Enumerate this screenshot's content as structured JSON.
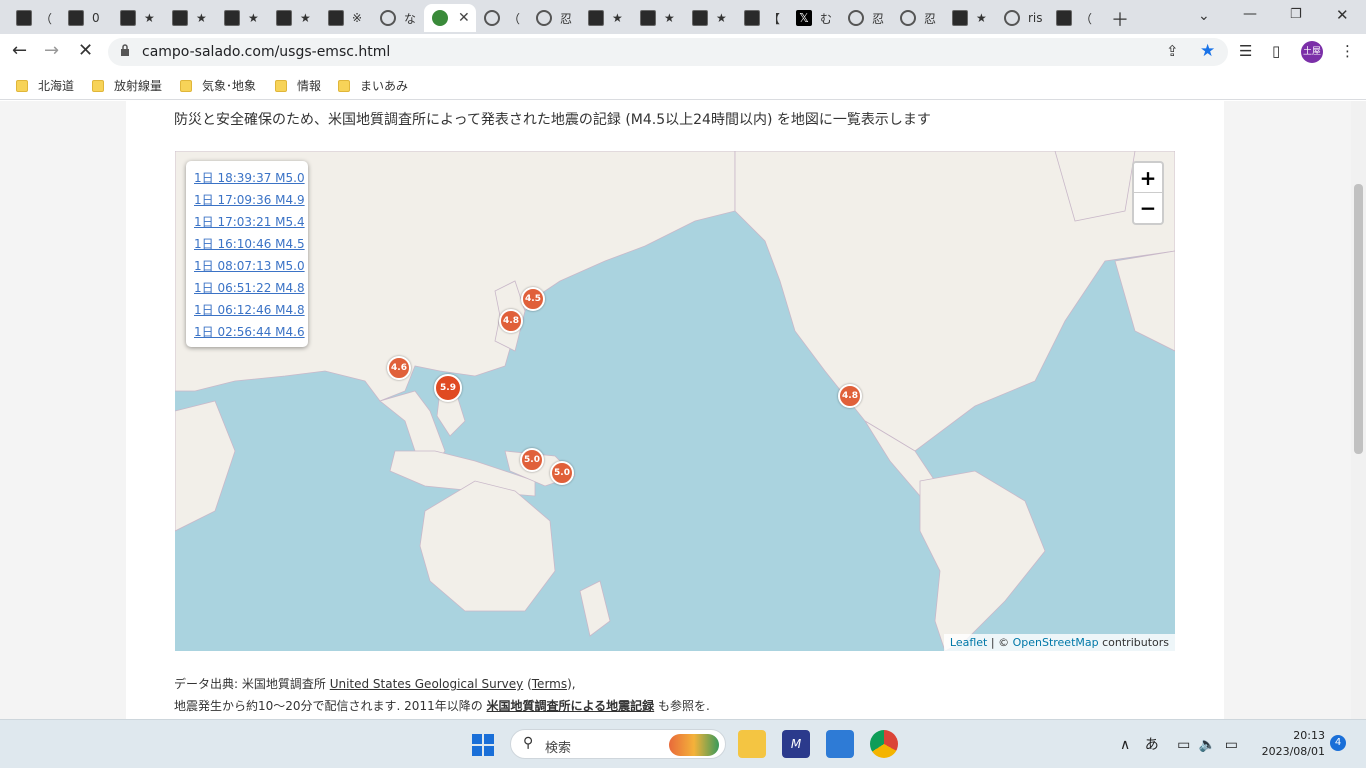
{
  "tabs": [
    {
      "label": "（",
      "icon": "site-icon"
    },
    {
      "label": "0",
      "icon": "site-icon"
    },
    {
      "label": "★",
      "icon": "site-icon"
    },
    {
      "label": "★",
      "icon": "site-icon"
    },
    {
      "label": "★",
      "icon": "site-icon"
    },
    {
      "label": "★",
      "icon": "site-icon"
    },
    {
      "label": "※",
      "icon": "site-icon"
    },
    {
      "label": "な",
      "icon": "globe-icon"
    },
    {
      "label": "",
      "icon": "campo-icon",
      "active": true
    },
    {
      "label": "（",
      "icon": "globe-icon"
    },
    {
      "label": "忍",
      "icon": "globe-icon"
    },
    {
      "label": "★",
      "icon": "site-icon"
    },
    {
      "label": "★",
      "icon": "site-icon"
    },
    {
      "label": "★",
      "icon": "site-icon"
    },
    {
      "label": "【",
      "icon": "site-icon"
    },
    {
      "label": "む",
      "icon": "x-icon"
    },
    {
      "label": "忍",
      "icon": "globe-icon"
    },
    {
      "label": "忍",
      "icon": "globe-icon"
    },
    {
      "label": "★",
      "icon": "site-icon"
    },
    {
      "label": "ris",
      "icon": "globe-icon"
    },
    {
      "label": "（",
      "icon": "site-icon"
    }
  ],
  "toolbar": {
    "url": "campo-salado.com/usgs-emsc.html",
    "avatar": "土屋"
  },
  "bookmarks": [
    "北海道",
    "放射線量",
    "気象･地象",
    "情報",
    "まいあみ"
  ],
  "page": {
    "intro": "防災と安全確保のため、米国地質調査所によって発表された地震の記録 (M4.5以上24時間以内) を地図に一覧表示します",
    "quake_list": [
      "1日 18:39:37 M5.0",
      "1日 17:09:36 M4.9",
      "1日 17:03:21 M5.4",
      "1日 16:10:46 M4.5",
      "1日 08:07:13 M5.0",
      "1日 06:51:22 M4.8",
      "1日 06:12:46 M4.8",
      "1日 02:56:44 M4.6"
    ],
    "markers": [
      "4.5",
      "4.8",
      "4.6",
      "5.9",
      "4.8",
      "5.0",
      "5.0"
    ],
    "zoom_in": "+",
    "zoom_out": "−",
    "attribution": {
      "leaflet": "Leaflet",
      "sep": " | © ",
      "osm": "OpenStreetMap",
      "contrib": " contributors"
    },
    "source": {
      "prefix": "データ出典: 米国地質調査所 ",
      "usgs": "United States Geological Survey",
      "terms": "Terms",
      "line2_prefix": "地震発生から約10～20分で配信されます. 2011年以降の ",
      "archive": "米国地質調査所による地震記録",
      "line2_suffix": " も参照を."
    }
  },
  "taskbar": {
    "search_placeholder": "検索",
    "ime": "あ",
    "time": "20:13",
    "date": "2023/08/01",
    "notifications": "4"
  }
}
